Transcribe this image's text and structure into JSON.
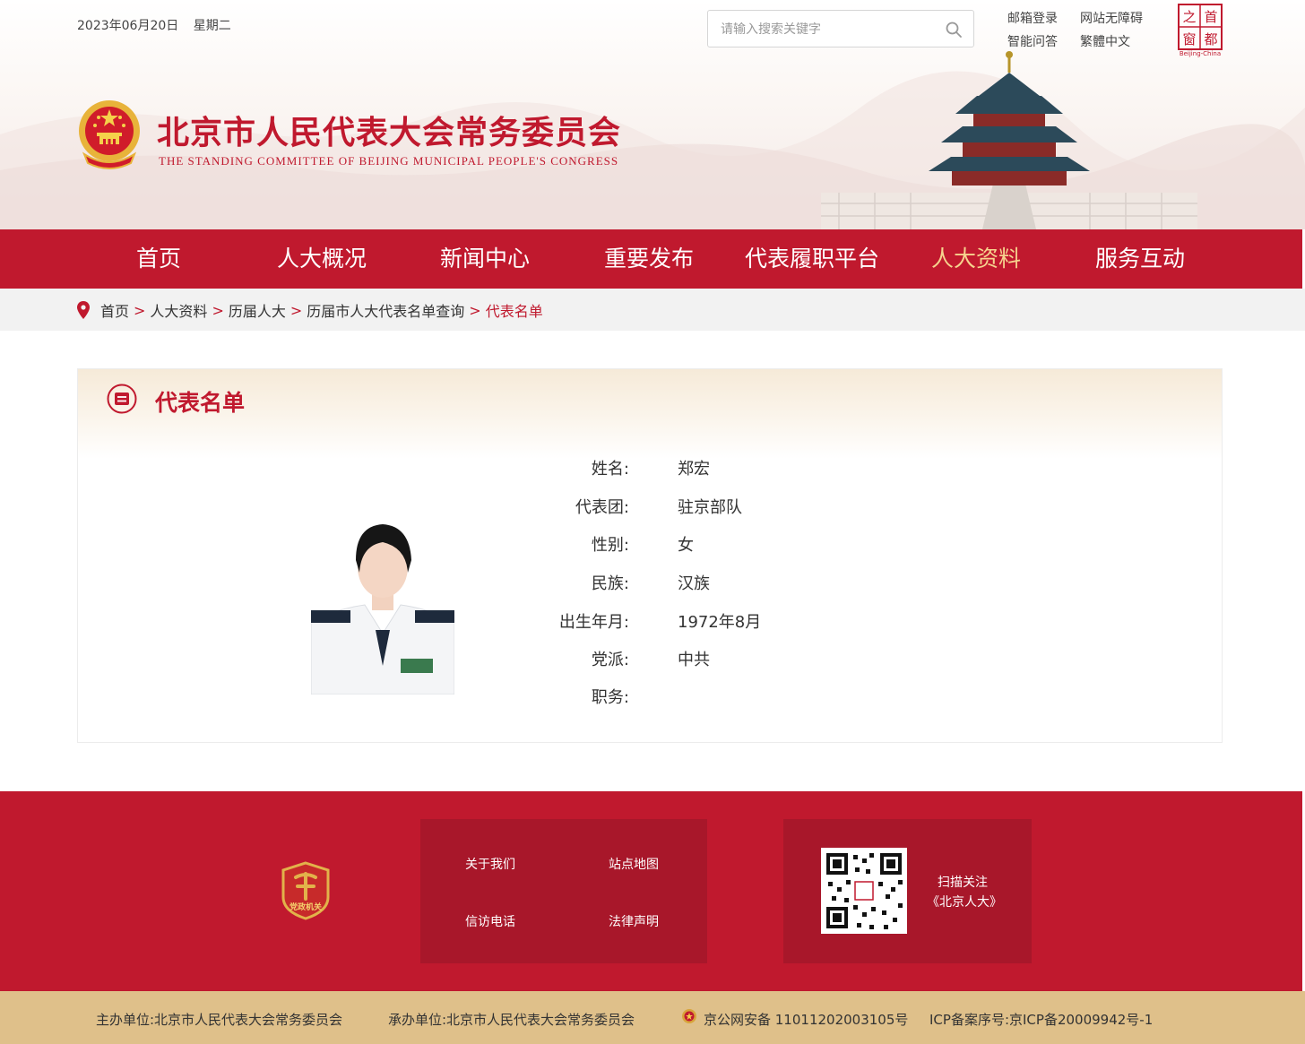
{
  "header": {
    "date": "2023年06月20日",
    "weekday": "星期二",
    "search_placeholder": "请输入搜索关键字",
    "top_links": [
      "邮箱登录",
      "网站无障碍",
      "智能问答",
      "繁體中文"
    ],
    "site_title": "北京市人民代表大会常务委员会",
    "site_subtitle": "THE STANDING COMMITTEE OF BEIJING MUNICIPAL PEOPLE'S CONGRESS",
    "beijing_logo_text": [
      "首",
      "都",
      "之",
      "窗"
    ],
    "beijing_logo_caption": "Beijing-China"
  },
  "nav": {
    "items": [
      "首页",
      "人大概况",
      "新闻中心",
      "重要发布",
      "代表履职平台",
      "人大资料",
      "服务互动"
    ],
    "active": "人大资料"
  },
  "breadcrumb": {
    "items": [
      "首页",
      "人大资料",
      "历届人大",
      "历届市人大代表名单查询"
    ],
    "current": "代表名单",
    "separator": ">"
  },
  "panel": {
    "title": "代表名单",
    "fields": [
      {
        "label": "姓名:",
        "value": "郑宏"
      },
      {
        "label": "代表团:",
        "value": "驻京部队"
      },
      {
        "label": "性别:",
        "value": "女"
      },
      {
        "label": "民族:",
        "value": "汉族"
      },
      {
        "label": "出生年月:",
        "value": "1972年8月"
      },
      {
        "label": "党派:",
        "value": "中共"
      },
      {
        "label": "职务:",
        "value": ""
      }
    ]
  },
  "footer": {
    "badge_text": "党政机关",
    "links": [
      "关于我们",
      "站点地图",
      "信访电话",
      "法律声明"
    ],
    "qr_text_1": "扫描关注",
    "qr_text_2": "《北京人大》",
    "sponsor": "主办单位:北京市人民代表大会常务委员会",
    "organizer": "承办单位:北京市人民代表大会常务委员会",
    "police_record": "京公网安备 11011202003105号",
    "icp_record": "ICP备案序号:京ICP备20009942号-1"
  },
  "colors": {
    "brand_red": "#c0192e",
    "dark_red": "#a8172a",
    "active_nav": "#f6d38e",
    "bottom_bar": "#dfc08a"
  }
}
